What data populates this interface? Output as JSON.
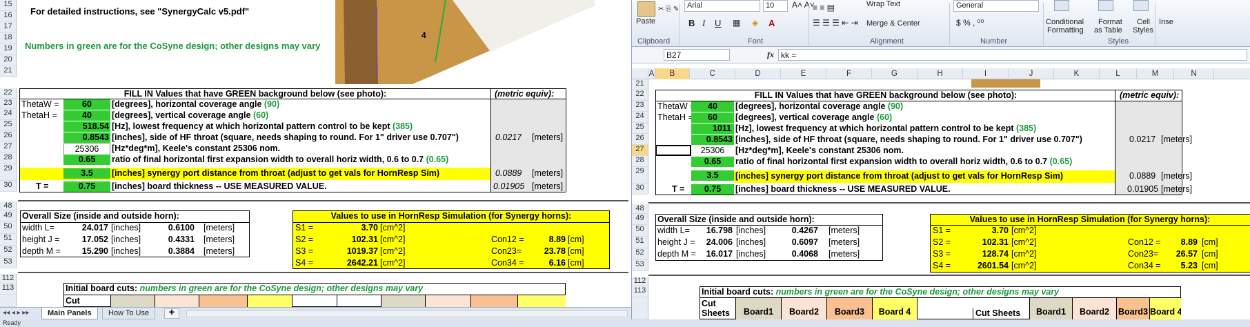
{
  "left": {
    "rows": [
      "15",
      "16",
      "17",
      "18",
      "19",
      "20",
      "21",
      "22",
      "23",
      "24",
      "25",
      "26",
      "27",
      "28",
      "29",
      "30",
      "48",
      "49",
      "50",
      "51",
      "52",
      "53",
      "112",
      "113",
      ""
    ],
    "instr": "For detailed instructions, see \"SynergyCalc v5.pdf\"",
    "green_note": "Numbers in green are for the CoSyne design; other designs may vary",
    "photo_label": "4",
    "fill_header": "FILL IN Values that have GREEN background below (see photo):",
    "metric_header": "(metric equiv):",
    "thetaw_label": "ThetaW =",
    "thetaw": "60",
    "thetah_label": "ThetaH =",
    "thetah": "40",
    "freq": "518.54",
    "thickness_label": "T =",
    "throat": "0.8543",
    "throat_m": "0.0217",
    "keele": "25306",
    "ratio": "0.65",
    "port": "3.5",
    "port_m": "0.0889",
    "t": "0.75",
    "t_m": "0.01905",
    "unit_m": "[meters]",
    "desc": {
      "d1a": "[degrees], horizontal coverage angle ",
      "d1b": "(90)",
      "d2a": "[degrees], vertical coverage angle ",
      "d2b": "(60)",
      "d3a": "[Hz], lowest frequency at which horizontal pattern control to be kept ",
      "d3b": "(385)",
      "d4": "[inches], side of HF throat (square, needs shaping to round. For 1\" driver use 0.707\")",
      "d5": "[Hz*deg*m], Keele's constant 25306 nom.",
      "d6a": "ratio of final horizontal first expansion width to overall horiz width, 0.6 to 0.7 ",
      "d6b": "(0.65)",
      "d7": "[inches] synergy port distance from throat (adjust to get vals for HornResp Sim)",
      "d8": "[inches] board thickness -- USE MEASURED VALUE."
    },
    "overall_title": "Overall Size (inside and outside horn):",
    "width_label": "width L=",
    "width_in": "24.017",
    "width_m": "0.6100",
    "height_label": "height J =",
    "height_in": "17.052",
    "height_m": "0.4331",
    "depth_label": "depth M =",
    "depth_in": "15.290",
    "depth_m": "0.3884",
    "unit_in": "[inches]",
    "hr_title": "Values to use in HornResp Simulation (for Synergy horns):",
    "s1_label": "S1 =",
    "s1": "3.70",
    "s2_label": "S2 =",
    "s2": "102.31",
    "s3_label": "S3 =",
    "s3": "1019.37",
    "s4_label": "S4 =",
    "s4": "2642.21",
    "cm2": "[cm^2]",
    "cm": "[cm]",
    "con12_label": "Con12 =",
    "con12": "8.89",
    "con23_label": "Con23=",
    "con23": "23.78",
    "con34_label": "Con34 =",
    "con34": "6.16",
    "board_title_a": "Initial board cuts: ",
    "board_title_b": "numbers in green are for the CoSyne design; other designs may vary",
    "cut_label": "Cut",
    "tab1": "Main Panels",
    "tab2": "How To Use"
  },
  "right": {
    "ribbon": {
      "paste": "Paste",
      "clipboard": "Clipboard",
      "font_name": "Arial",
      "font_size": "10",
      "font": "Font",
      "wrap": "Wrap Text",
      "merge": "Merge & Center",
      "alignment": "Alignment",
      "number_format": "General",
      "number": "Number",
      "cond": "Conditional",
      "cond2": "Formatting",
      "fmt_table": "Format",
      "fmt_table2": "as Table",
      "cell_styles": "Cell",
      "cell_styles2": "Styles",
      "styles": "Styles",
      "insert": "Inse"
    },
    "name_box": "B27",
    "fx": "fx",
    "formula": "kk =",
    "cols": [
      "A",
      "B",
      "C",
      "D",
      "E",
      "F",
      "G",
      "H",
      "I",
      "J",
      "K",
      "L",
      "M",
      "N"
    ],
    "rows": [
      "21",
      "22",
      "23",
      "24",
      "25",
      "26",
      "27",
      "28",
      "29",
      "30",
      "48",
      "49",
      "50",
      "51",
      "52",
      "53",
      "112",
      "113",
      ""
    ],
    "fill_header": "FILL IN Values that have GREEN background below (see photo):",
    "metric_header": "(metric equiv):",
    "thetaw_label": "ThetaW =",
    "thetaw": "40",
    "thetah_label": "ThetaH =",
    "thetah": "60",
    "freq": "1011",
    "throat": "0.8543",
    "throat_m": "0.0217",
    "keele": "25306",
    "ratio": "0.65",
    "port": "3.5",
    "port_m": "0.0889",
    "t_label": "T =",
    "t": "0.75",
    "t_m": "0.01905",
    "unit_m": "[meters]",
    "width_label": "width L=",
    "width_in": "16.798",
    "width_m": "0.4267",
    "height_label": "height J =",
    "height_in": "24.006",
    "height_m": "0.6097",
    "depth_label": "depth M =",
    "depth_in": "16.017",
    "depth_m": "0.4068",
    "s1": "3.70",
    "s2": "102.31",
    "s3": "128.74",
    "s4": "2601.54",
    "con12": "8.89",
    "con23": "26.57",
    "con34": "5.23",
    "cut_sheets": "Cut",
    "cut_sheets2": "Sheets",
    "board1": "Board1",
    "board2": "Board2",
    "board3": "Board3",
    "board4": "Board 4",
    "cut_sheets_b": "Cut Sheets"
  },
  "status": "Ready",
  "colors": {
    "green": "#33cc33",
    "yellow": "#ffff00",
    "green_text": "#1a9a3a"
  }
}
